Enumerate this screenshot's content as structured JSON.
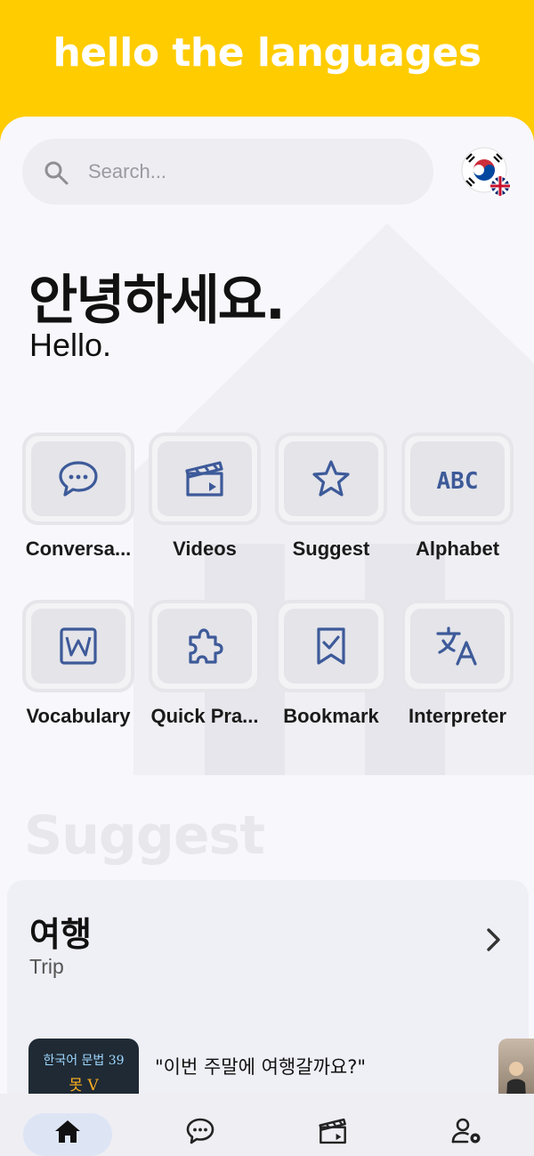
{
  "app": {
    "title": "hello the languages"
  },
  "search": {
    "placeholder": "Search..."
  },
  "language": {
    "flag_from": "south-korea-flag-icon",
    "flag_to": "uk-flag-icon"
  },
  "greeting": {
    "korean": "안녕하세요.",
    "english": "Hello."
  },
  "tiles": [
    {
      "label": "Conversa...",
      "icon": "chat-bubble-icon"
    },
    {
      "label": "Videos",
      "icon": "clapperboard-icon"
    },
    {
      "label": "Suggest",
      "icon": "star-icon"
    },
    {
      "label": "Alphabet",
      "icon": "abc-icon"
    },
    {
      "label": "Vocabulary",
      "icon": "word-doc-icon"
    },
    {
      "label": "Quick Pra...",
      "icon": "puzzle-icon"
    },
    {
      "label": "Bookmark",
      "icon": "bookmark-check-icon"
    },
    {
      "label": "Interpreter",
      "icon": "translate-icon"
    }
  ],
  "suggest": {
    "heading": "Suggest",
    "card": {
      "topic_korean": "여행",
      "topic_english": "Trip",
      "video": {
        "thumb_line1": "한국어 문법 39",
        "thumb_line2": "못 V",
        "quote": "\"이번 주말에 여행갈까요?\""
      }
    }
  },
  "bottom_nav": [
    {
      "name": "home",
      "icon": "home-icon",
      "active": true
    },
    {
      "name": "conversation",
      "icon": "chat-bubble-icon",
      "active": false
    },
    {
      "name": "videos",
      "icon": "clapperboard-icon",
      "active": false
    },
    {
      "name": "settings",
      "icon": "user-settings-icon",
      "active": false
    }
  ],
  "colors": {
    "accent": "#ffcc00",
    "icon": "#3d5a99",
    "background": "#f8f8fc"
  }
}
